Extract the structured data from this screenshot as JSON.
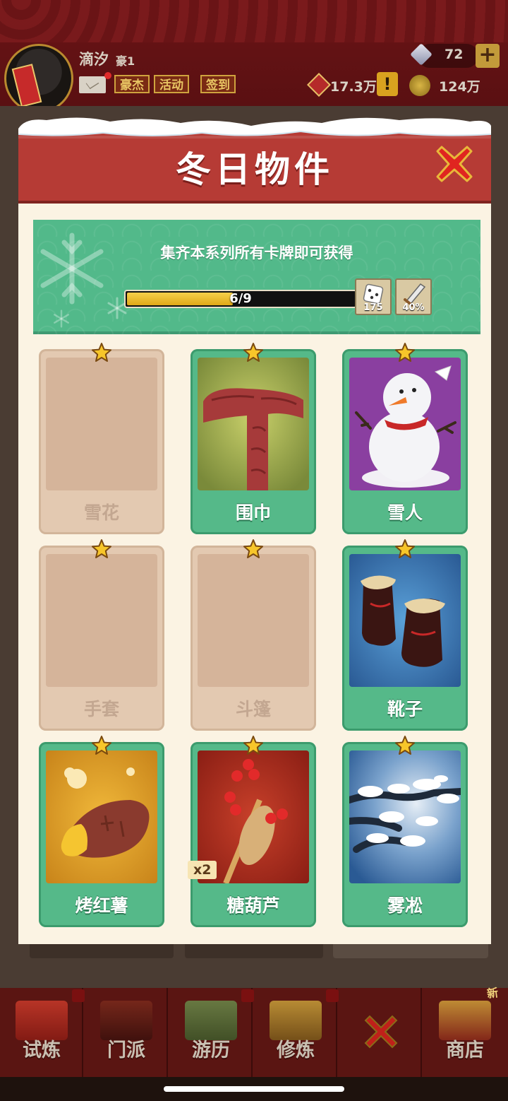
{
  "player": {
    "name": "滴汐",
    "rank": "豪1"
  },
  "header_buttons": [
    "豪杰",
    "活动",
    "签到"
  ],
  "resources": {
    "gems": "72",
    "currency_a": "17.3万",
    "currency_b": "124万"
  },
  "modal": {
    "title": "冬日物件",
    "collect_text": "集齐本系列所有卡牌即可获得",
    "progress": {
      "current": 6,
      "total": 9,
      "label": "6/9"
    },
    "rewards": [
      {
        "icon": "dice-icon",
        "label": "175"
      },
      {
        "icon": "sword-icon",
        "label": "40%"
      }
    ],
    "cards": [
      {
        "name": "雪花",
        "owned": false,
        "art": "snowflake",
        "count": ""
      },
      {
        "name": "围巾",
        "owned": true,
        "art": "scarf",
        "count": ""
      },
      {
        "name": "雪人",
        "owned": true,
        "art": "snowman",
        "count": ""
      },
      {
        "name": "手套",
        "owned": false,
        "art": "gloves",
        "count": ""
      },
      {
        "name": "斗篷",
        "owned": false,
        "art": "cloak",
        "count": ""
      },
      {
        "name": "靴子",
        "owned": true,
        "art": "boots",
        "count": ""
      },
      {
        "name": "烤红薯",
        "owned": true,
        "art": "sweet-potato",
        "count": ""
      },
      {
        "name": "糖葫芦",
        "owned": true,
        "art": "candied-haws",
        "count": "x2"
      },
      {
        "name": "雾凇",
        "owned": true,
        "art": "rime",
        "count": ""
      }
    ]
  },
  "bottom_nav": [
    {
      "label": "试炼",
      "icon": "trial-icon"
    },
    {
      "label": "门派",
      "icon": "sect-icon"
    },
    {
      "label": "游历",
      "icon": "travel-icon"
    },
    {
      "label": "修炼",
      "icon": "cultivate-icon"
    },
    {
      "label": "",
      "icon": "close-icon"
    },
    {
      "label": "商店",
      "icon": "shop-icon"
    }
  ],
  "nav_badge": "新"
}
